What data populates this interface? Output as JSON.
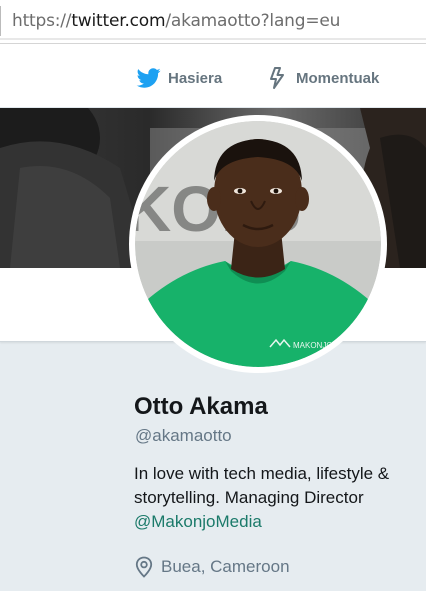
{
  "browser": {
    "url_scheme": "https://",
    "url_host": "twitter.com",
    "url_path": "/akamaotto?lang=eu"
  },
  "nav": {
    "home_icon": "twitter-bird-icon",
    "home_label": "Hasiera",
    "moments_icon": "lightning-icon",
    "moments_label": "Momentuak"
  },
  "colors": {
    "twitter_blue": "#1da1f2",
    "nav_gray": "#66757f",
    "mention_green": "#1b7a6a",
    "shirt_green": "#17b26a"
  },
  "profile": {
    "name": "Otto Akama",
    "handle": "@akamaotto",
    "bio_text": "In love with tech media, lifestyle & storytelling. Managing Director",
    "bio_mention": "@MakonjoMedia",
    "location_icon": "location-pin-icon",
    "location": "Buea, Cameroon"
  }
}
